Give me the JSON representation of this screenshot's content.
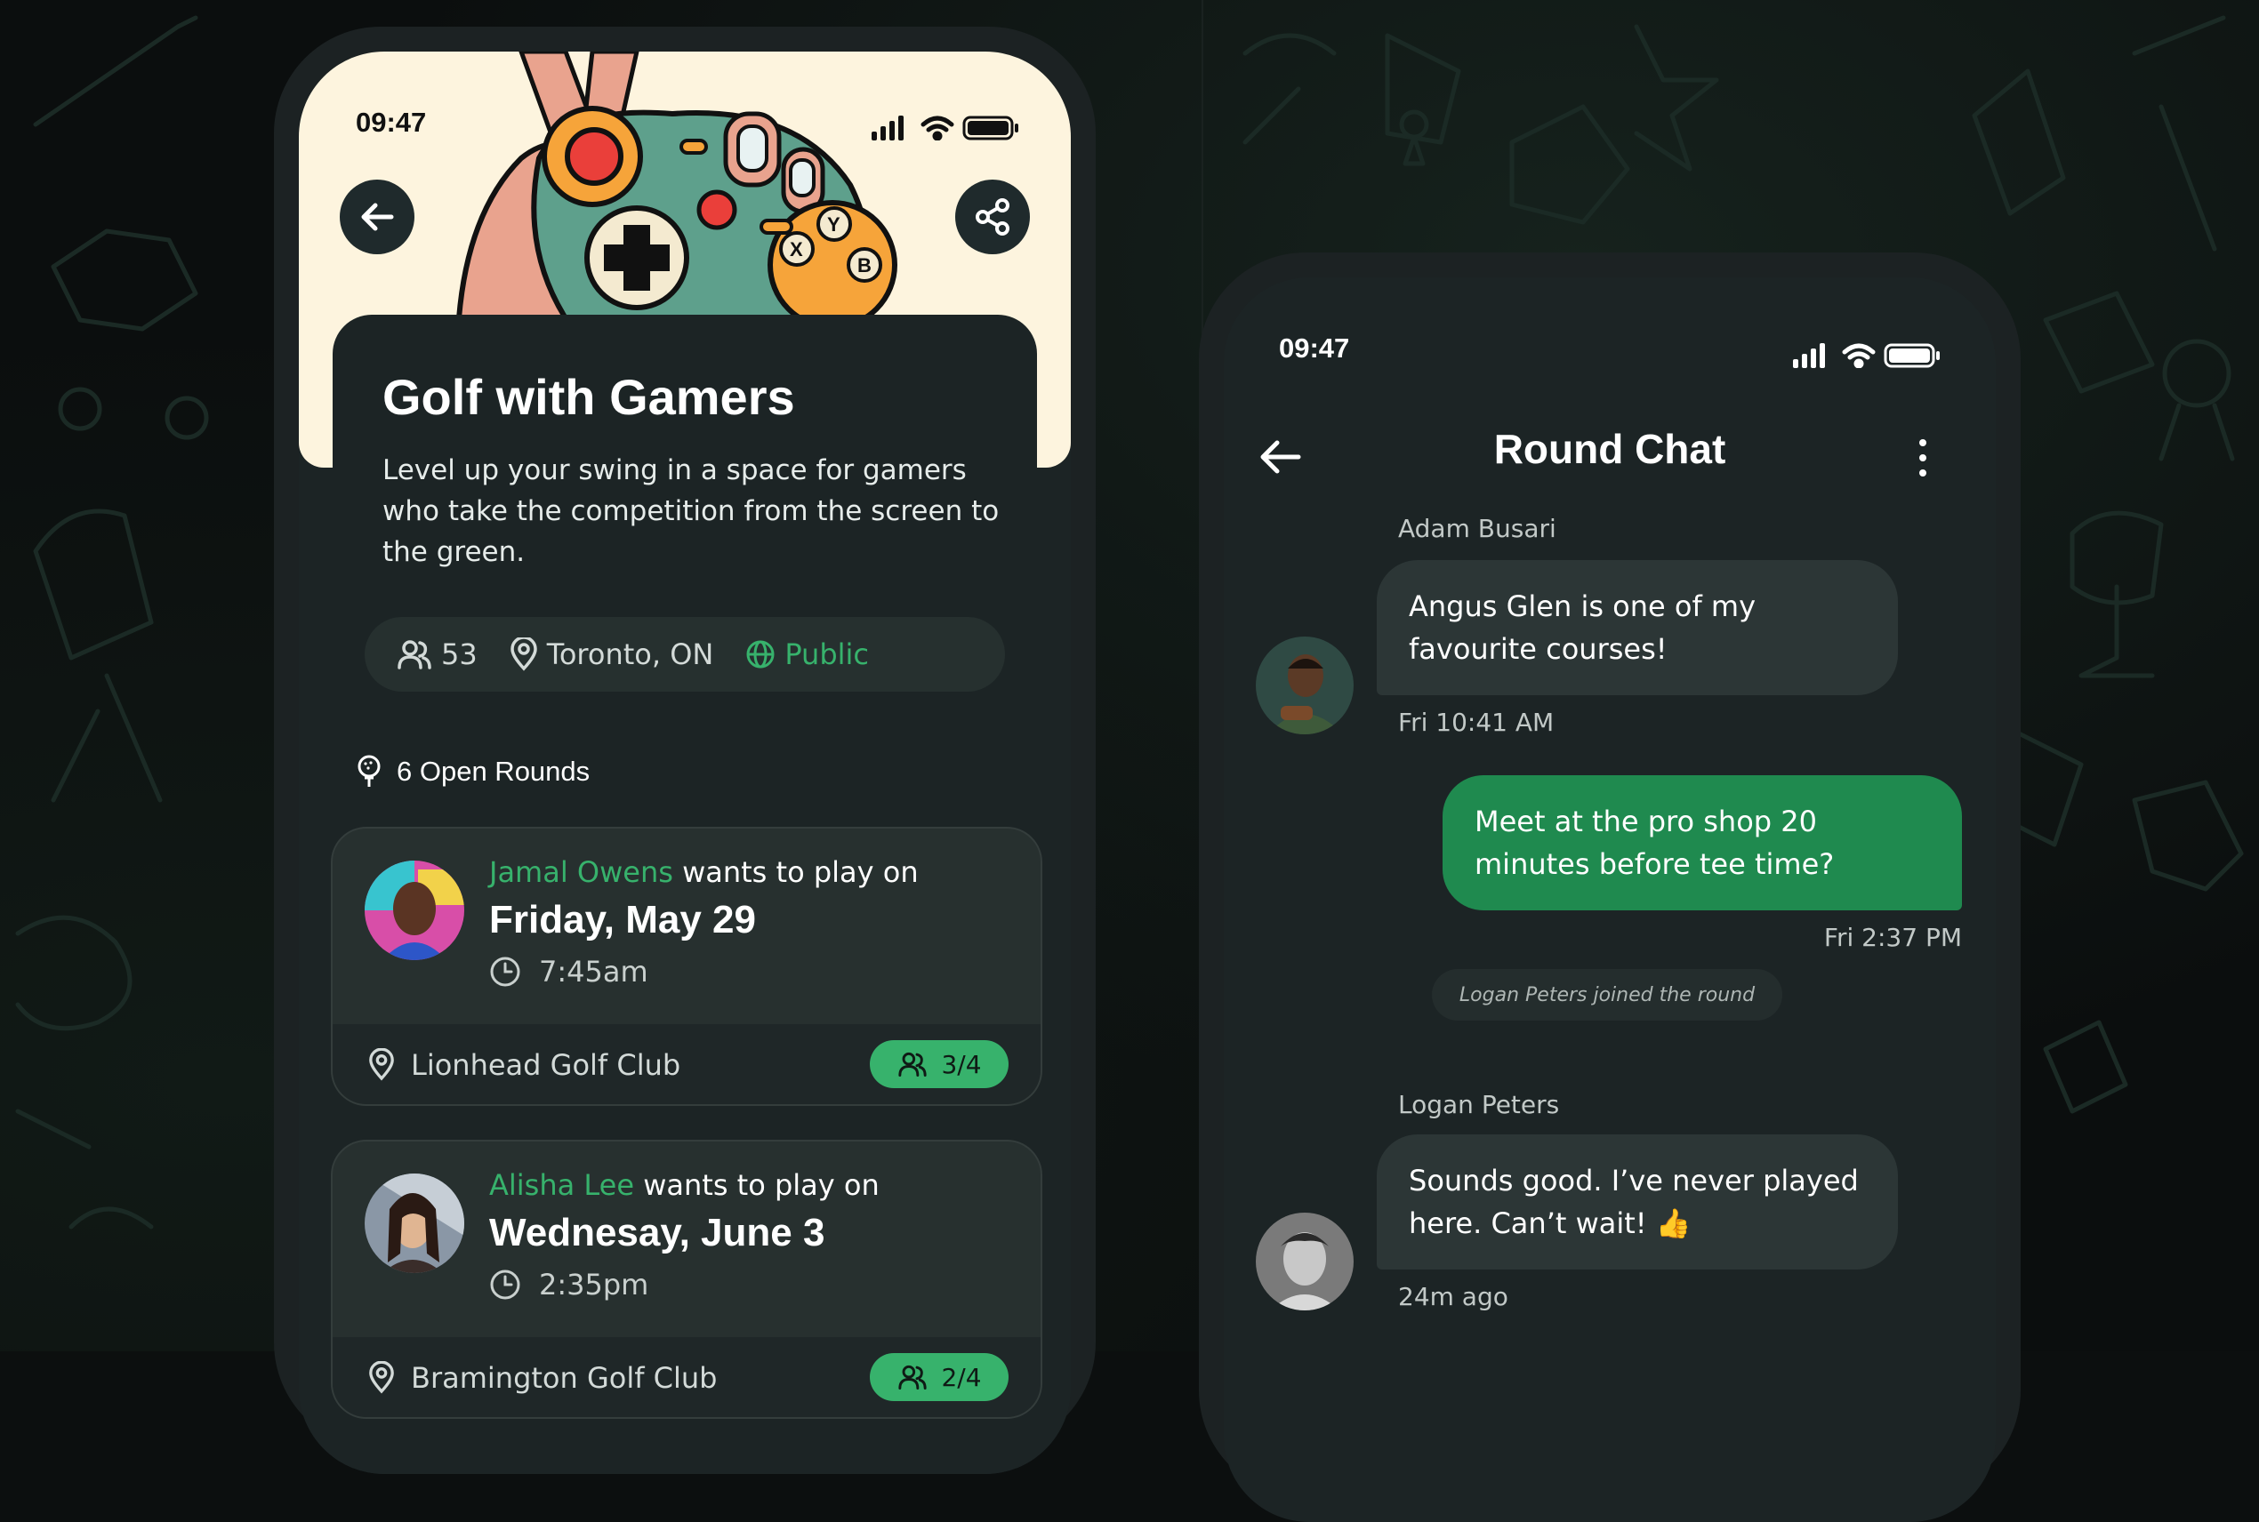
{
  "left_phone": {
    "status_time": "09:47",
    "group": {
      "title": "Golf with Gamers",
      "description": "Level up your swing in a space for gamers who take the competition from the screen to the green.",
      "members": "53",
      "location": "Toronto, ON",
      "visibility": "Public"
    },
    "open_rounds_label": "6 Open Rounds",
    "rounds": [
      {
        "name": "Jamal Owens",
        "suffix": "wants to play on",
        "date": "Friday, May 29",
        "time": "7:45am",
        "club": "Lionhead Golf Club",
        "spots": "3/4"
      },
      {
        "name": "Alisha Lee",
        "suffix": "wants to play on",
        "date": "Wednesay, June 3",
        "time": "2:35pm",
        "club": "Bramington Golf Club",
        "spots": "2/4"
      }
    ]
  },
  "right_phone": {
    "status_time": "09:47",
    "title": "Round Chat",
    "messages": [
      {
        "sender": "Adam Busari",
        "text": "Angus Glen is one of my favourite courses!",
        "time": "Fri 10:41 AM"
      },
      {
        "sender": "",
        "text": "Meet at the pro shop 20 minutes before tee time?",
        "time": "Fri 2:37 PM"
      },
      {
        "system": "Logan Peters joined the round"
      },
      {
        "sender": "Logan Peters",
        "text": "Sounds good. I’ve never played here. Can’t wait! 👍",
        "time": "24m ago"
      }
    ]
  },
  "colors": {
    "accent": "#37b26c",
    "bubble_out": "#1f8a4f",
    "card": "#27302f",
    "hero": "#fdf4de"
  },
  "icons": [
    "back-arrow-icon",
    "share-icon",
    "people-icon",
    "location-pin-icon",
    "globe-icon",
    "golf-ball-tee-icon",
    "clock-icon",
    "kebab-menu-icon",
    "signal-icon",
    "wifi-icon",
    "battery-icon"
  ]
}
